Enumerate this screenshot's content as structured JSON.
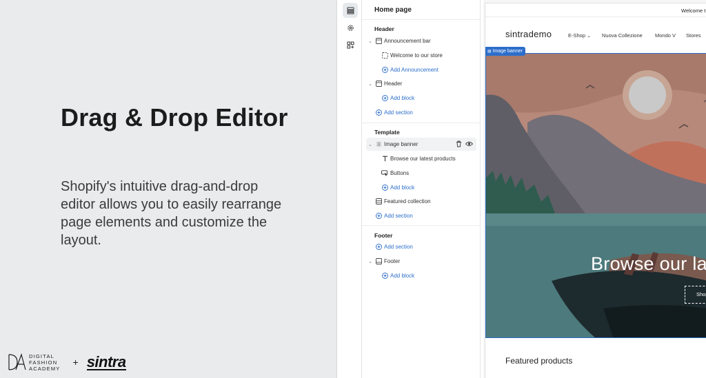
{
  "promo": {
    "title": "Drag & Drop Editor",
    "body": "Shopify's intuitive drag-and-drop editor allows you to easily rearrange page elements and customize the layout.",
    "logo_lines": [
      "DIGITAL",
      "FASHION",
      "ACADEMY"
    ],
    "plus": "+",
    "partner": "sintra"
  },
  "rail": {
    "icons": [
      "sections-icon",
      "settings-gear-icon",
      "apps-blocks-icon"
    ]
  },
  "tree": {
    "title": "Home page",
    "header_group": "Header",
    "announcement_bar": "Announcement bar",
    "welcome_item": "Welcome to our store",
    "add_announcement": "Add Announcement",
    "header_item": "Header",
    "add_block_1": "Add block",
    "add_section_1": "Add section",
    "template_group": "Template",
    "image_banner": "Image banner",
    "browse_item": "Browse our latest products",
    "buttons_item": "Buttons",
    "add_block_2": "Add block",
    "featured_collection": "Featured collection",
    "add_section_2": "Add section",
    "footer_group": "Footer",
    "add_section_3": "Add section",
    "footer_item": "Footer",
    "add_block_3": "Add block"
  },
  "preview": {
    "announcement": "Welcome t",
    "brand": "sintrademo",
    "nav": [
      "E-Shop",
      "Nuova Collezione",
      "Mondo V",
      "Stores"
    ],
    "banner_tag": "Image banner",
    "hero_heading": "Browse our la",
    "shop_button": "Shop",
    "featured": "Featured products"
  },
  "colors": {
    "accent": "#2c6ecb",
    "sky": "#b7897a",
    "water": "#4d7a7c",
    "mountain": "#5f5e66"
  }
}
